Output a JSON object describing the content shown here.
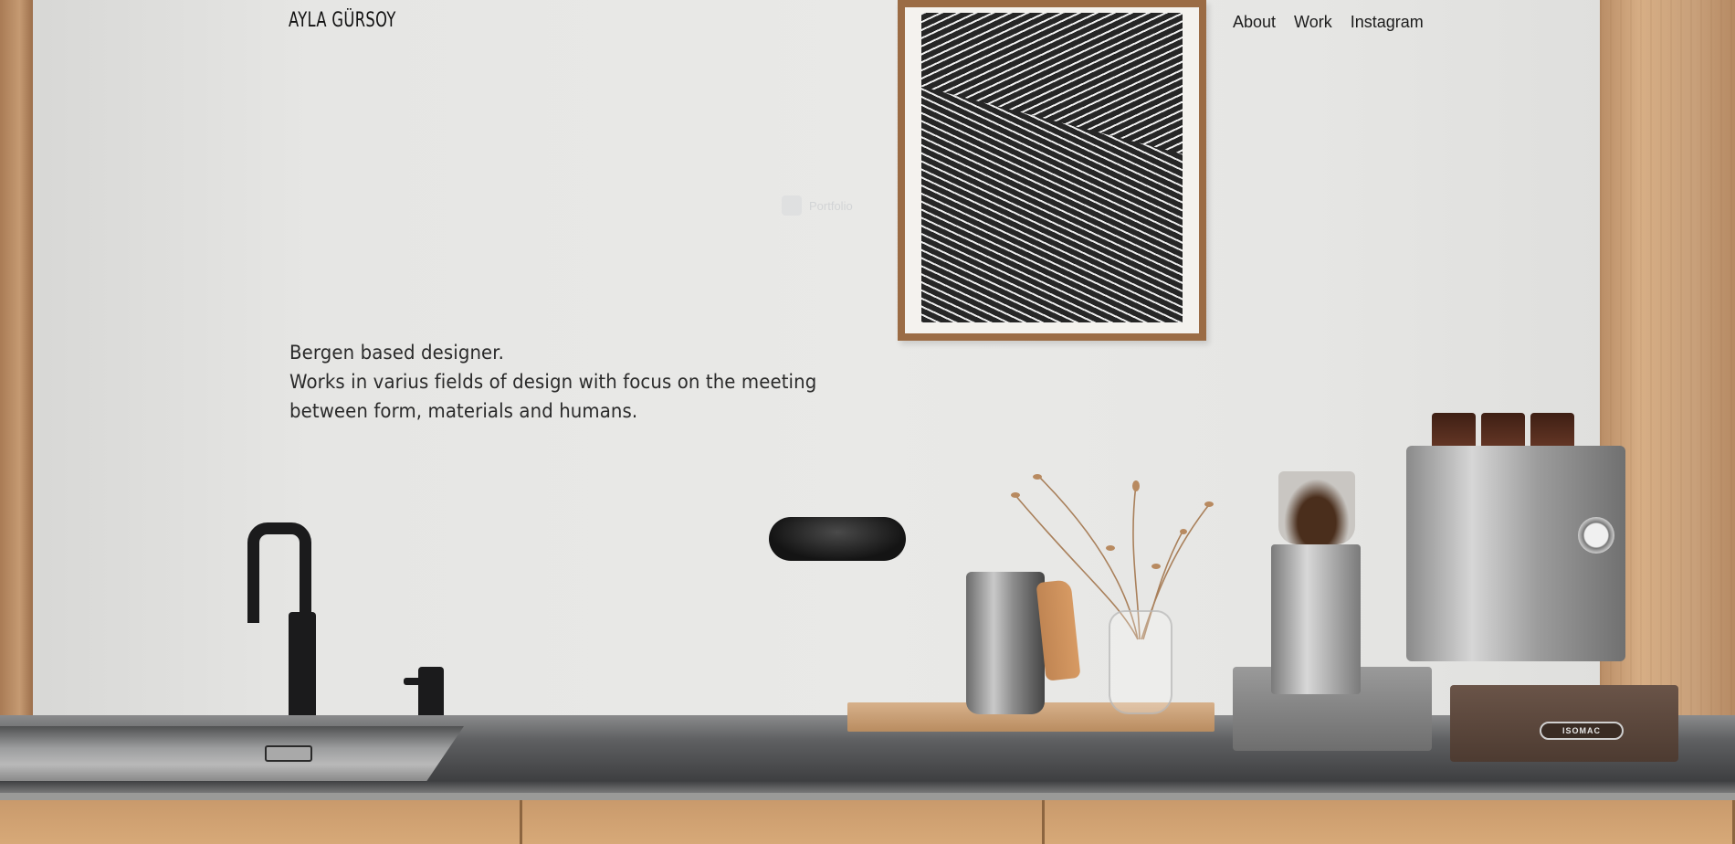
{
  "header": {
    "logo": "AYLA GÜRSOY",
    "nav": [
      {
        "label": "About"
      },
      {
        "label": "Work"
      },
      {
        "label": "Instagram"
      }
    ]
  },
  "overlay_badge": {
    "label": "Portfolio"
  },
  "intro": {
    "lines": [
      "Bergen based designer.",
      "Works in varius fields of design with focus on the meeting",
      "between form, materials and humans."
    ]
  },
  "hero_image": {
    "product_badge": "ISOMAC"
  },
  "colors": {
    "text": "#2a2a2a",
    "wall": "#e6e6e4",
    "wood": "#c99a6c"
  }
}
